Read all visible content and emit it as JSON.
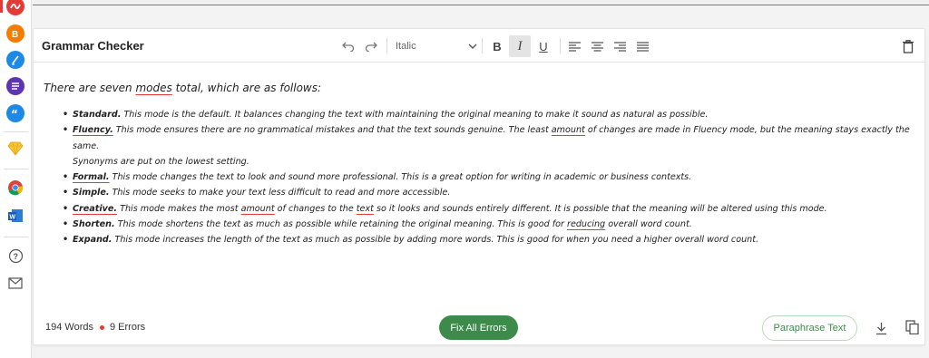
{
  "app": {
    "title": "Grammar Checker"
  },
  "toolbar": {
    "font_style": "Italic",
    "bold_label": "B",
    "italic_label": "I",
    "underline_label": "U",
    "undo_icon": "undo-icon",
    "redo_icon": "redo-icon",
    "delete_icon": "trash-icon"
  },
  "content": {
    "intro": "There are seven modes total, which are as follows:",
    "modes": [
      {
        "name": "Standard.",
        "text": " This mode is the default. It balances changing the text with maintaining the original meaning to make it sound as natural as possible."
      },
      {
        "name": "Fluency.",
        "text_1": " This mode ensures there are no grammatical mistakes and that the text sounds genuine. The least ",
        "err": "amount",
        "text_2": " of changes are made in Fluency mode, but the meaning stays exactly the same.",
        "text_3": "Synonyms are put on the lowest setting."
      },
      {
        "name": "Formal.",
        "text": " This mode changes the text to look and sound more professional. This is a great option for writing in academic or business contexts."
      },
      {
        "name": "Simple.",
        "text": " This mode seeks to make your text less difficult to read and more accessible."
      },
      {
        "name": "Creative.",
        "text_1": " This mode makes the most ",
        "err_1": "amount",
        "text_2": " of changes to the ",
        "err_2": "text",
        "text_3": " so it looks and sounds entirely different. It is possible that the meaning will be altered using this mode."
      },
      {
        "name": "Shorten.",
        "text_1": " This mode shortens the text as much as possible while retaining the original meaning. This is good for ",
        "err": "reducing",
        "text_2": " overall word count."
      },
      {
        "name": "Expand.",
        "text": " This mode increases the length of the text as much as possible by adding more words. This is good for when you need a higher overall word count."
      }
    ]
  },
  "footer": {
    "word_count": "194 Words",
    "error_count": "9 Errors",
    "fix_all_label": "Fix All Errors",
    "paraphrase_label": "Paraphrase Text"
  },
  "colors": {
    "accent_green": "#3d8b4a",
    "error_red": "#e53935"
  },
  "rail": {
    "icons": [
      "app-logo-icon",
      "blog-icon",
      "edit-icon",
      "list-icon",
      "quote-icon",
      "diamond-icon",
      "chrome-icon",
      "word-icon",
      "help-icon",
      "mail-icon"
    ]
  }
}
